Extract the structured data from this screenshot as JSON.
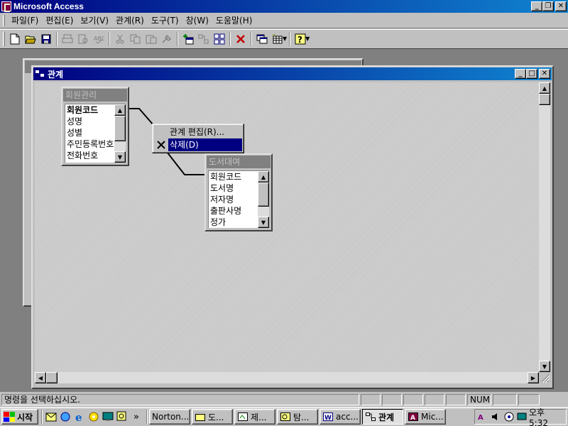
{
  "app": {
    "title": "Microsoft Access"
  },
  "menu": {
    "items": [
      "파일(F)",
      "편집(E)",
      "보기(V)",
      "관계(R)",
      "도구(T)",
      "창(W)",
      "도움말(H)"
    ]
  },
  "toolbar": {
    "icons": [
      "new-icon",
      "open-icon",
      "save-icon",
      "print-icon",
      "print-preview-icon",
      "spelling-icon",
      "cut-icon",
      "copy-icon",
      "paste-icon",
      "format-painter-icon",
      "show-table-icon",
      "show-direct-icon",
      "show-all-icon",
      "delete-icon",
      "database-window-icon",
      "new-object-icon",
      "help-icon"
    ]
  },
  "relationships_window": {
    "title": "관계"
  },
  "tables": [
    {
      "name": "회원관리",
      "fields": [
        "회원코드",
        "성명",
        "성별",
        "주민등록번호",
        "전화번호"
      ],
      "key_field": "회원코드"
    },
    {
      "name": "도서대여",
      "fields": [
        "회원코드",
        "도서명",
        "저자명",
        "출판사명",
        "정가"
      ]
    }
  ],
  "context_menu": {
    "items": [
      {
        "label": "관계 편집(R)...",
        "selected": false,
        "icon": ""
      },
      {
        "label": "삭제(D)",
        "selected": true,
        "icon": "delete-x-icon"
      }
    ]
  },
  "status": {
    "message": "명령을 선택하십시오.",
    "num": "NUM"
  },
  "taskbar": {
    "start": "시작",
    "more": "»",
    "tasks": [
      {
        "label": "Norton...",
        "icon": "norton-icon",
        "active": false
      },
      {
        "label": "도...",
        "icon": "folder-icon",
        "active": false
      },
      {
        "label": "제...",
        "icon": "control-icon",
        "active": false
      },
      {
        "label": "탐...",
        "icon": "explorer-icon",
        "active": false
      },
      {
        "label": "acc...",
        "icon": "word-icon",
        "active": false
      },
      {
        "label": "관계",
        "icon": "relationships-icon",
        "active": true
      },
      {
        "label": "Mic...",
        "icon": "access-icon",
        "active": false
      }
    ],
    "clock": "오후 5:32"
  }
}
